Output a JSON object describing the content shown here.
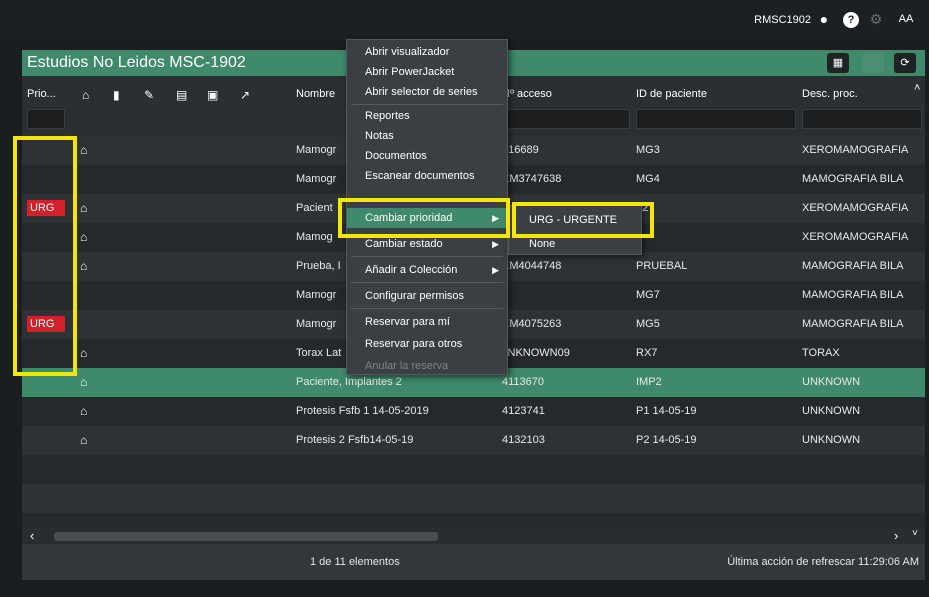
{
  "topbar": {
    "user": "RMSC1902",
    "chat_icon": "chat-icon",
    "help_icon": "help-icon",
    "settings_icon": "gear-icon",
    "font_label": "AA"
  },
  "panel": {
    "title": "Estudios No Leidos MSC-1902",
    "header_buttons": [
      "layout-icon",
      "hidden-panel-icon",
      "refresh-icon"
    ]
  },
  "columns": {
    "priority": "Prio...",
    "icons": [
      "home-icon",
      "document-icon",
      "edit-icon",
      "report-icon",
      "lock-icon",
      "pin-icon"
    ],
    "name": "Nombre",
    "access": "Nº acceso",
    "patient_id": "ID de paciente",
    "desc": "Desc. proc."
  },
  "rows": [
    {
      "priority": "",
      "home": true,
      "name": "Mamogr",
      "access": "416689",
      "patient_id": "MG3",
      "desc": "XEROMAMOGRAFIA"
    },
    {
      "priority": "",
      "home": false,
      "name": "Mamogr",
      "access": "EM3747638",
      "patient_id": "MG4",
      "desc": "MAMOGRAFIA BILA"
    },
    {
      "priority": "URG",
      "home": true,
      "name": "Pacient",
      "access": "",
      "patient_id": "?2",
      "desc": "XEROMAMOGRAFIA"
    },
    {
      "priority": "",
      "home": true,
      "name": "Mamog",
      "access": "",
      "patient_id": "3",
      "desc": "XEROMAMOGRAFIA"
    },
    {
      "priority": "",
      "home": true,
      "name": "Prueba, I",
      "access": "EM4044748",
      "patient_id": "PRUEBAL",
      "desc": "MAMOGRAFIA BILA"
    },
    {
      "priority": "",
      "home": false,
      "name": "Mamogr",
      "access": "",
      "patient_id": "MG7",
      "desc": "MAMOGRAFIA BILA"
    },
    {
      "priority": "URG",
      "home": false,
      "name": "Mamogr",
      "access": "EM4075263",
      "patient_id": "MG5",
      "desc": "MAMOGRAFIA BILA"
    },
    {
      "priority": "",
      "home": true,
      "name": "Torax Lat",
      "access": "JNKNOWN09",
      "patient_id": "RX7",
      "desc": "TORAX"
    },
    {
      "priority": "",
      "home": true,
      "name": "Paciente, Implantes 2",
      "access": "4113670",
      "patient_id": "IMP2",
      "desc": "UNKNOWN"
    },
    {
      "priority": "",
      "home": true,
      "name": "Protesis Fsfb 1 14-05-2019",
      "access": "4123741",
      "patient_id": "P1 14-05-19",
      "desc": "UNKNOWN"
    },
    {
      "priority": "",
      "home": true,
      "name": "Protesis 2 Fsfb14-05-19",
      "access": "4132103",
      "patient_id": "P2 14-05-19",
      "desc": "UNKNOWN"
    }
  ],
  "context_menu": {
    "items": [
      "Abrir visualizador",
      "Abrir PowerJacket",
      "Abrir selector de series",
      "Reportes",
      "Notas",
      "Documentos",
      "Escanear documentos",
      "Cambiar prioridad",
      "Cambiar estado",
      "Añadir a Colección",
      "Configurar permisos",
      "Reservar para mí",
      "Reservar para otros",
      "Anular la reserva"
    ],
    "submenu": [
      "URG - URGENTE",
      "None"
    ]
  },
  "footer": {
    "count": "1 de 11 elementos",
    "refresh": "Última acción de refrescar 11:29:06 AM"
  },
  "colors": {
    "accent": "#3e8a6a",
    "urgent": "#d3202a",
    "highlight": "#f5e50b"
  }
}
